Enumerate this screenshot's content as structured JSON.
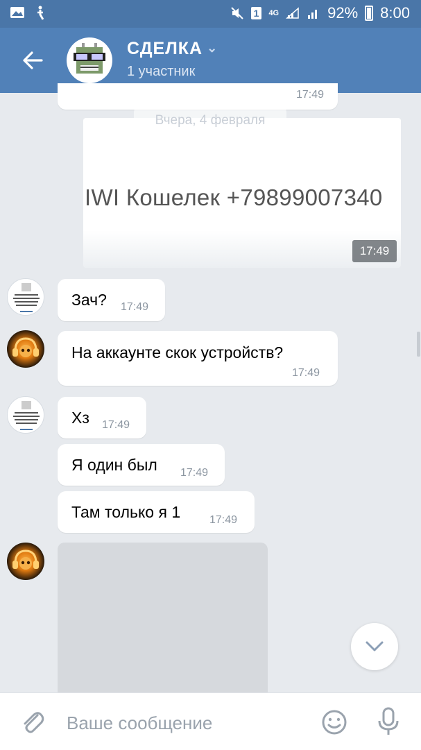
{
  "status_bar": {
    "icons_left": [
      "gallery-icon",
      "accessibility-icon"
    ],
    "sim_label": "1",
    "network": "4G",
    "battery": "92%",
    "time": "8:00"
  },
  "header": {
    "title": "СДЕЛКА",
    "subtitle": "1 участник"
  },
  "chat": {
    "top_time": "17:49",
    "date_chip": "Вчера, 4 февраля",
    "photo": {
      "text": "IWI Кошелек +79899007340",
      "time": "17:49"
    },
    "messages": [
      {
        "text": "Зач?",
        "time": "17:49"
      },
      {
        "text": "На аккаунте скок устройств?",
        "time": "17:49"
      },
      {
        "text": "Хз",
        "time": "17:49"
      },
      {
        "text": "Я один был",
        "time": "17:49"
      },
      {
        "text": "Там только я 1",
        "time": "17:49"
      }
    ]
  },
  "input": {
    "placeholder": "Ваше сообщение"
  },
  "colors": {
    "header": "#5181b8",
    "statusbar": "#4a76a8",
    "background": "#e7eaee"
  }
}
